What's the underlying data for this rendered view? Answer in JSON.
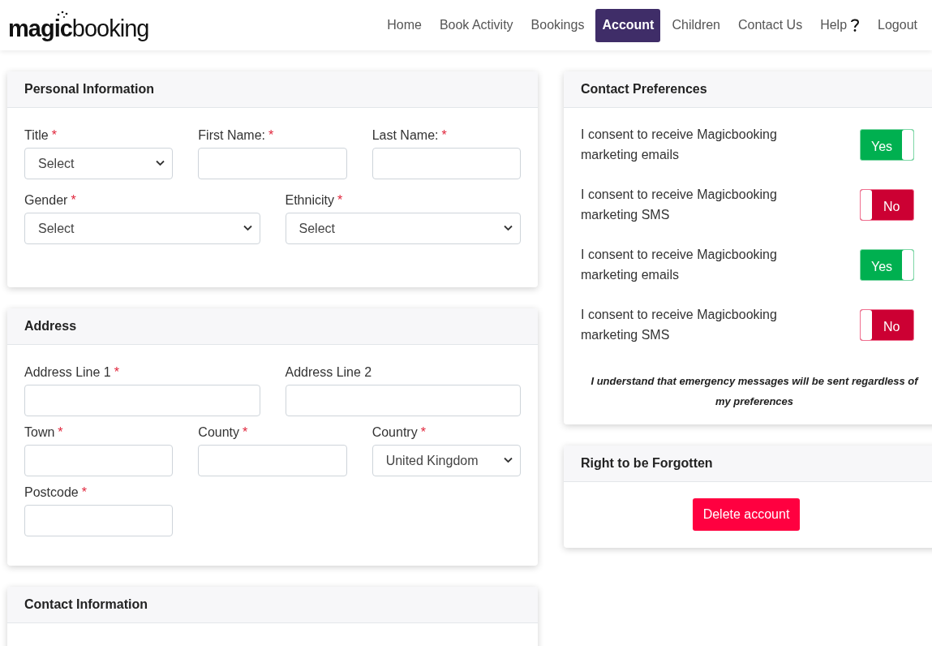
{
  "logo": {
    "bold": "magic",
    "light": "booking"
  },
  "nav": [
    {
      "label": "Home",
      "selected": false
    },
    {
      "label": "Book Activity",
      "selected": false
    },
    {
      "label": "Bookings",
      "selected": false
    },
    {
      "label": "Account",
      "selected": true
    },
    {
      "label": "Children",
      "selected": false
    },
    {
      "label": "Contact Us",
      "selected": false
    },
    {
      "label": "Help",
      "selected": false,
      "kind": "help"
    },
    {
      "label": "Logout",
      "selected": false
    }
  ],
  "personal_information": {
    "title": "Personal Information",
    "rows": [
      [
        {
          "label": "Title",
          "required_mark": "*",
          "kind": "select",
          "value": "Select"
        },
        {
          "label": "First Name:",
          "required_mark": "*",
          "kind": "text"
        },
        {
          "label": "Last Name:",
          "required_mark": "*",
          "kind": "text"
        }
      ],
      [
        {
          "label": "Gender",
          "required_mark": "*",
          "kind": "select",
          "value": "Select"
        },
        {
          "label": "Ethnicity",
          "required_mark": "*",
          "kind": "select",
          "value": "Select"
        }
      ]
    ]
  },
  "address": {
    "title": "Address",
    "rows": [
      [
        {
          "label": "Address Line 1",
          "required_mark": "*",
          "kind": "text"
        },
        {
          "label": "Address Line 2",
          "kind": "text"
        }
      ],
      [
        {
          "label": "Town",
          "required_mark": "*",
          "kind": "text"
        },
        {
          "label": "County",
          "required_mark": "*",
          "kind": "text"
        },
        {
          "label": "Country",
          "required_mark": "*",
          "kind": "select",
          "value": "United Kingdom"
        }
      ],
      [
        {
          "label": "Postcode",
          "required_mark": "*",
          "kind": "text"
        },
        {
          "kind": "empty"
        },
        {
          "kind": "empty"
        }
      ]
    ]
  },
  "contact_information": {
    "title": "Contact Information"
  },
  "contact_preferences": {
    "title": "Contact Preferences",
    "items": [
      {
        "text": "I consent to receive Magicbooking marketing emails",
        "on": true,
        "label": "Yes"
      },
      {
        "text": "I consent to receive Magicbooking marketing SMS",
        "on": false,
        "label": "No"
      },
      {
        "text": "I consent to receive Magicbooking marketing emails",
        "on": true,
        "label": "Yes"
      },
      {
        "text": "I consent to receive Magicbooking marketing SMS",
        "on": false,
        "label": "No"
      }
    ],
    "note": "I understand that emergency messages will be sent regardless of my preferences"
  },
  "right_to_be_forgotten": {
    "title": "Right to be Forgotten",
    "button": "Delete account"
  }
}
